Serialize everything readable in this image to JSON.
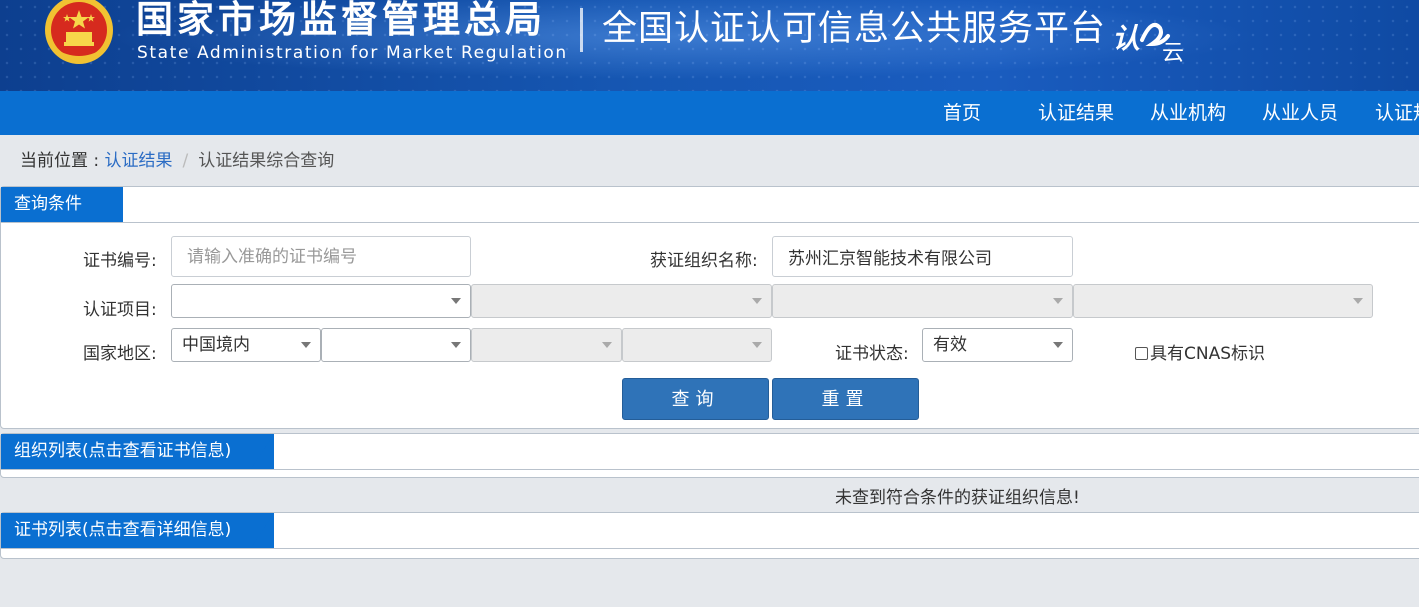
{
  "header": {
    "org_name_cn": "国家市场监督管理总局",
    "org_name_en": "State Administration  for  Market Regulation",
    "platform_title": "全国认证认可信息公共服务平台",
    "cloud_logo_text": "认云"
  },
  "nav": {
    "items": [
      "首页",
      "认证结果",
      "从业机构",
      "从业人员",
      "认证规"
    ]
  },
  "breadcrumb": {
    "prefix": "当前位置 : ",
    "parent": "认证结果",
    "separator": "/",
    "current": "认证结果综合查询"
  },
  "query": {
    "section_title": "查询条件",
    "cert_no_label": "证书编号:",
    "cert_no_placeholder": "请输入准确的证书编号",
    "cert_no_value": "",
    "org_name_label": "获证组织名称:",
    "org_name_value": "苏州汇京智能技术有限公司",
    "project_label": "认证项目:",
    "project_selects": [
      "",
      "",
      "",
      ""
    ],
    "region_label": "国家地区:",
    "region_selects": [
      "中国境内",
      "",
      "",
      ""
    ],
    "status_label": "证书状态:",
    "status_value": "有效",
    "cnas_label": "具有CNAS标识",
    "cnas_checked": false,
    "search_button": "查询",
    "reset_button": "重置"
  },
  "org_list": {
    "section_title": "组织列表(点击查看证书信息)",
    "empty_message": "未查到符合条件的获证组织信息!"
  },
  "cert_list": {
    "section_title": "证书列表(点击查看详细信息)"
  },
  "colors": {
    "nav_bg": "#0a6fd1",
    "banner_bg": "#1657b3",
    "button_bg": "#2f73b8",
    "link": "#2b6cc4",
    "page_bg": "#e5e8ec"
  }
}
